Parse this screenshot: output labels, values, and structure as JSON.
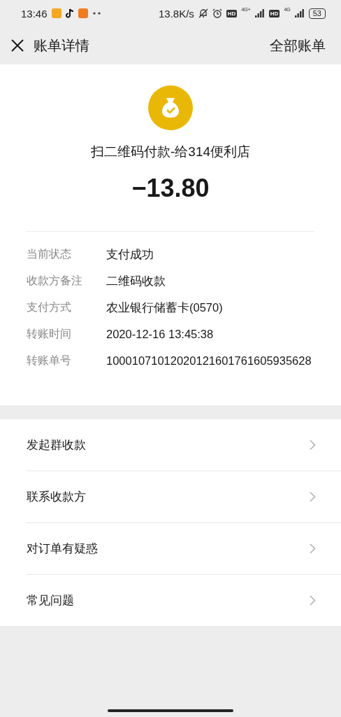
{
  "status_bar": {
    "time": "13:46",
    "speed": "13.8K/s",
    "sim1_hd": "HD",
    "sim1_net": "4G+",
    "sim2_hd": "HD",
    "sim2_net": "4G",
    "battery": "53"
  },
  "header": {
    "title": "账单详情",
    "action": "全部账单"
  },
  "payment": {
    "title": "扫二维码付款-给314便利店",
    "amount": "−13.80"
  },
  "details": [
    {
      "label": "当前状态",
      "value": "支付成功"
    },
    {
      "label": "收款方备注",
      "value": "二维码收款"
    },
    {
      "label": "支付方式",
      "value": "农业银行储蓄卡(0570)"
    },
    {
      "label": "转账时间",
      "value": "2020-12-16 13:45:38"
    },
    {
      "label": "转账单号",
      "value": "10001071012020121601761605935628"
    }
  ],
  "actions": [
    {
      "label": "发起群收款"
    },
    {
      "label": "联系收款方"
    },
    {
      "label": "对订单有疑惑"
    },
    {
      "label": "常见问题"
    }
  ]
}
